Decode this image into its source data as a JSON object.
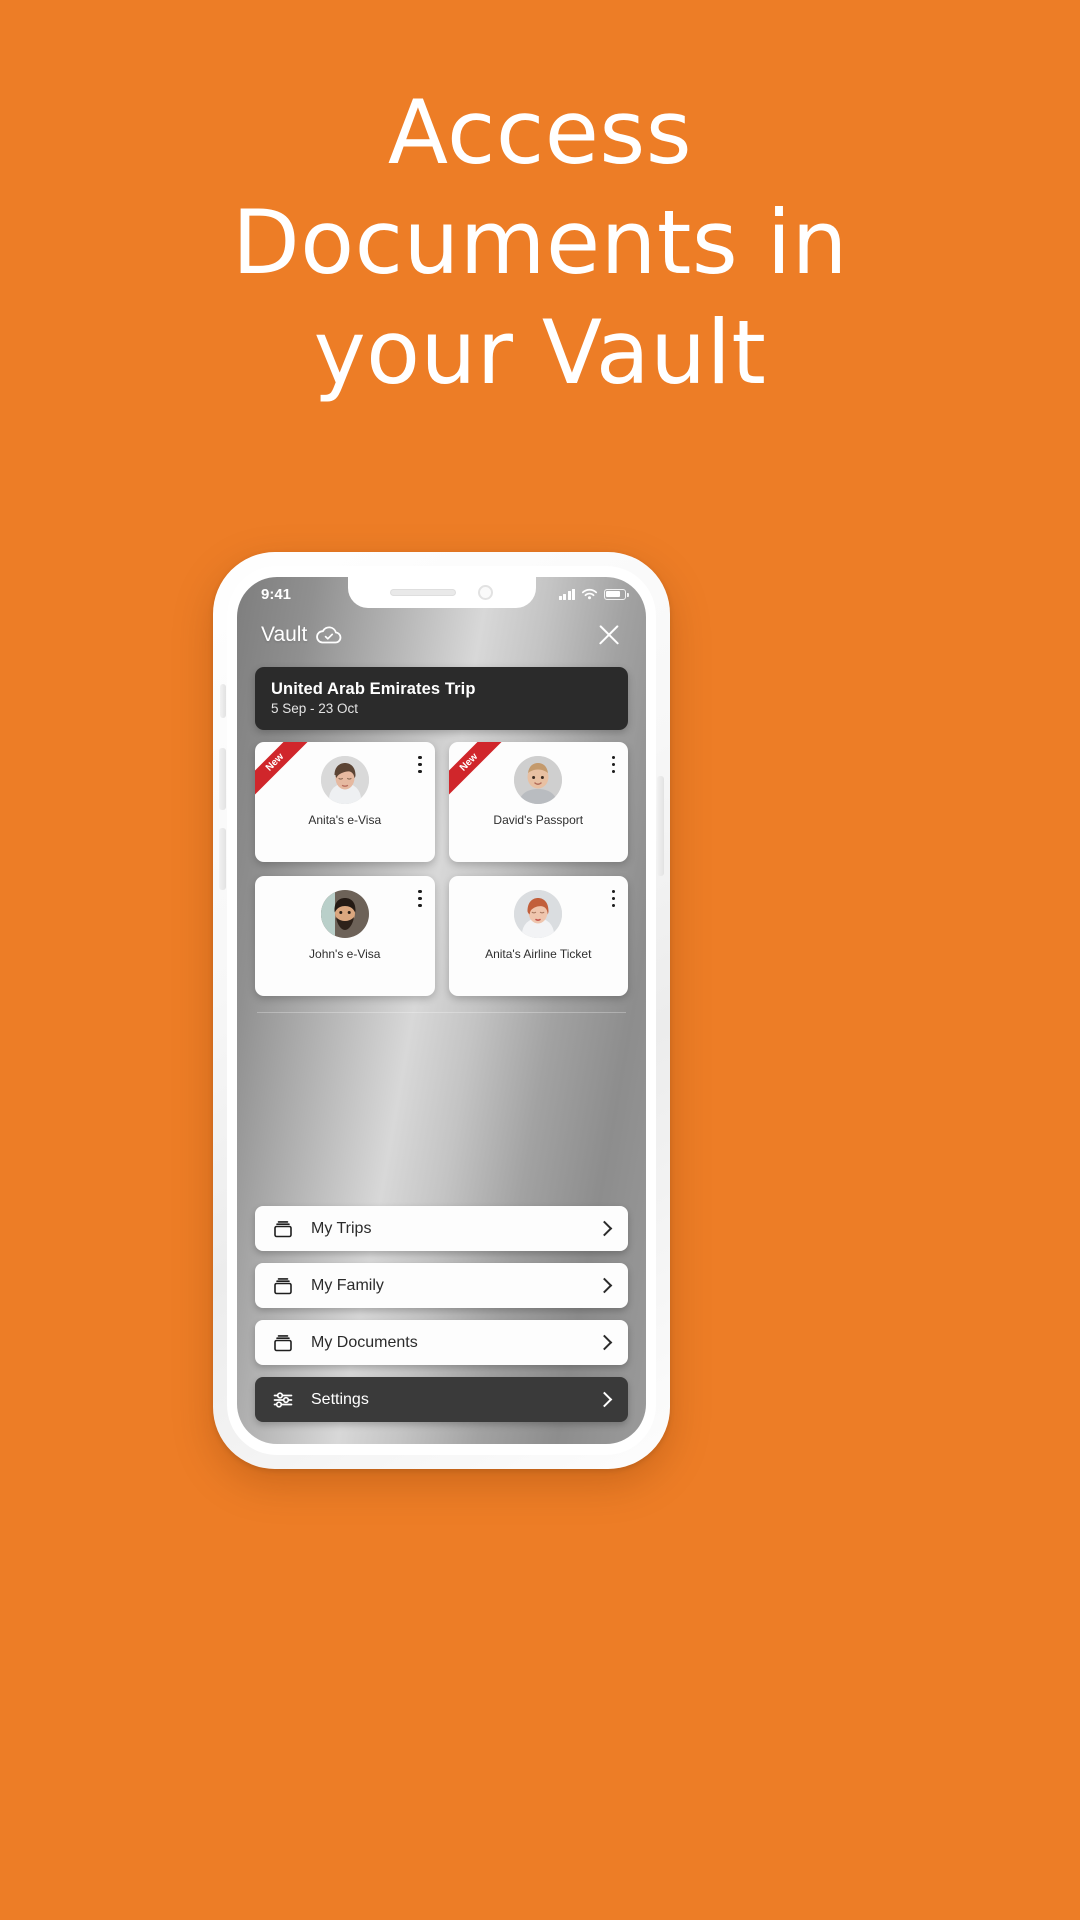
{
  "background_color": "#ED7D26",
  "headline": {
    "lines": [
      "Access",
      "Documents in",
      "your Vault"
    ]
  },
  "phone": {
    "status_bar": {
      "time": "9:41",
      "icons": [
        "signal-bars-icon",
        "wifi-icon",
        "battery-icon"
      ]
    },
    "app_header": {
      "title": "Vault",
      "cloud_icon": "cloud-check-icon",
      "close_icon": "close-icon"
    },
    "trip_card": {
      "title": "United Arab Emirates Trip",
      "dates": "5 Sep - 23 Oct",
      "background": "#2b2b2b"
    },
    "documents": [
      {
        "label": "Anita's e-Visa",
        "badge": "New",
        "avatar": "woman-blonde"
      },
      {
        "label": "David's Passport",
        "badge": "New",
        "avatar": "baby"
      },
      {
        "label": "John's e-Visa",
        "badge": "",
        "avatar": "man-beard"
      },
      {
        "label": "Anita's Airline Ticket",
        "badge": "",
        "avatar": "woman-red"
      }
    ],
    "badge_color": "#D0262B",
    "menu": [
      {
        "label": "My Trips",
        "icon": "archive-box-icon",
        "dark": false
      },
      {
        "label": "My Family",
        "icon": "archive-box-icon",
        "dark": false
      },
      {
        "label": "My Documents",
        "icon": "archive-box-icon",
        "dark": false
      },
      {
        "label": "Settings",
        "icon": "sliders-icon",
        "dark": true
      }
    ]
  }
}
